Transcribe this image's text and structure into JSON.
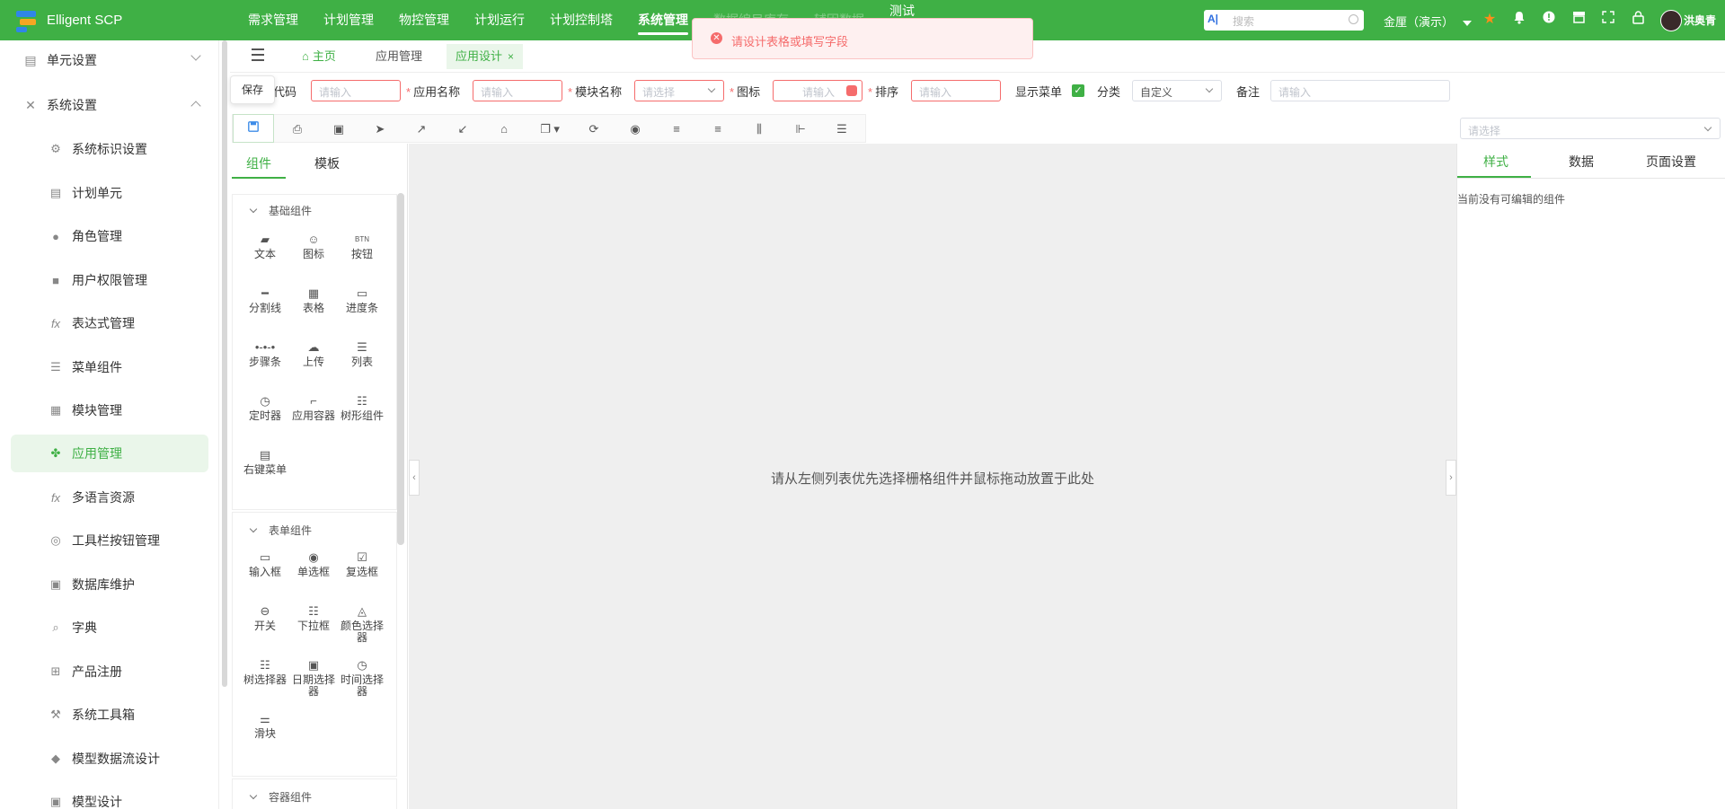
{
  "app": {
    "title": "Elligent SCP"
  },
  "topnav": {
    "items": [
      "需求管理",
      "计划管理",
      "物控管理",
      "计划运行",
      "计划控制塔",
      "系统管理",
      "数据编目库存",
      "辅因数据",
      "测试"
    ],
    "active": "系统管理"
  },
  "header": {
    "search_placeholder": "搜索",
    "tenant": "金厘（演示）",
    "username": "洪奥青"
  },
  "sidebar": {
    "groups": [
      {
        "label": "单元设置",
        "expanded": false
      },
      {
        "label": "系统设置",
        "expanded": true
      }
    ],
    "items": [
      {
        "label": "系统标识设置",
        "icon": "gear-icon"
      },
      {
        "label": "计划单元",
        "icon": "document-icon"
      },
      {
        "label": "角色管理",
        "icon": "users-icon"
      },
      {
        "label": "用户权限管理",
        "icon": "lock-icon"
      },
      {
        "label": "表达式管理",
        "icon": "function-icon"
      },
      {
        "label": "菜单组件",
        "icon": "list-icon"
      },
      {
        "label": "模块管理",
        "icon": "table-icon"
      },
      {
        "label": "应用管理",
        "icon": "clover-icon",
        "active": true
      },
      {
        "label": "多语言资源",
        "icon": "function-icon"
      },
      {
        "label": "工具栏按钮管理",
        "icon": "fingerprint-icon"
      },
      {
        "label": "数据库维护",
        "icon": "database-icon"
      },
      {
        "label": "字典",
        "icon": "dictionary-icon"
      },
      {
        "label": "产品注册",
        "icon": "register-icon"
      },
      {
        "label": "系统工具箱",
        "icon": "tools-icon"
      },
      {
        "label": "模型数据流设计",
        "icon": "cube-icon"
      },
      {
        "label": "模型设计",
        "icon": "database-icon"
      }
    ]
  },
  "tabs": [
    {
      "label": "主页",
      "icon": "home-icon"
    },
    {
      "label": "应用管理"
    },
    {
      "label": "应用设计",
      "active": true,
      "closable": true
    }
  ],
  "toast": {
    "message": "请设计表格或填写字段",
    "type": "error"
  },
  "form": {
    "save_tooltip": "保存",
    "code_label": "代码",
    "app_name_label": "应用名称",
    "app_name_placeholder": "请输入",
    "module_name_label": "模块名称",
    "module_name_placeholder": "请选择",
    "icon_label": "图标",
    "icon_placeholder": "请输入",
    "sort_label": "排序",
    "sort_placeholder": "请输入",
    "code_placeholder": "请输入",
    "show_menu_label": "显示菜单",
    "show_menu_checked": true,
    "category_label": "分类",
    "category_value": "自定义",
    "remark_label": "备注",
    "remark_placeholder": "请输入"
  },
  "palette": {
    "tabs": [
      "组件",
      "模板"
    ],
    "active_tab": "组件",
    "sections": [
      {
        "title": "基础组件",
        "items": [
          "文本",
          "图标",
          "按钮",
          "分割线",
          "表格",
          "进度条",
          "步骤条",
          "上传",
          "列表",
          "定时器",
          "应用容器",
          "树形组件",
          "右键菜单"
        ]
      },
      {
        "title": "表单组件",
        "items": [
          "输入框",
          "单选框",
          "复选框",
          "开关",
          "下拉框",
          "颜色选择器",
          "树选择器",
          "日期选择器",
          "时间选择器",
          "滑块"
        ]
      },
      {
        "title": "容器组件",
        "items": []
      }
    ]
  },
  "canvas": {
    "hint": "请从左侧列表优先选择栅格组件并鼠标拖动放置于此处"
  },
  "right_panel": {
    "select_placeholder": "请选择",
    "tabs": [
      "样式",
      "数据",
      "页面设置"
    ],
    "active_tab": "样式",
    "empty_text": "当前没有可编辑的组件"
  },
  "colors": {
    "brand": "#3fb045",
    "error": "#f56c6c",
    "accent_blue": "#3e8ce8"
  }
}
